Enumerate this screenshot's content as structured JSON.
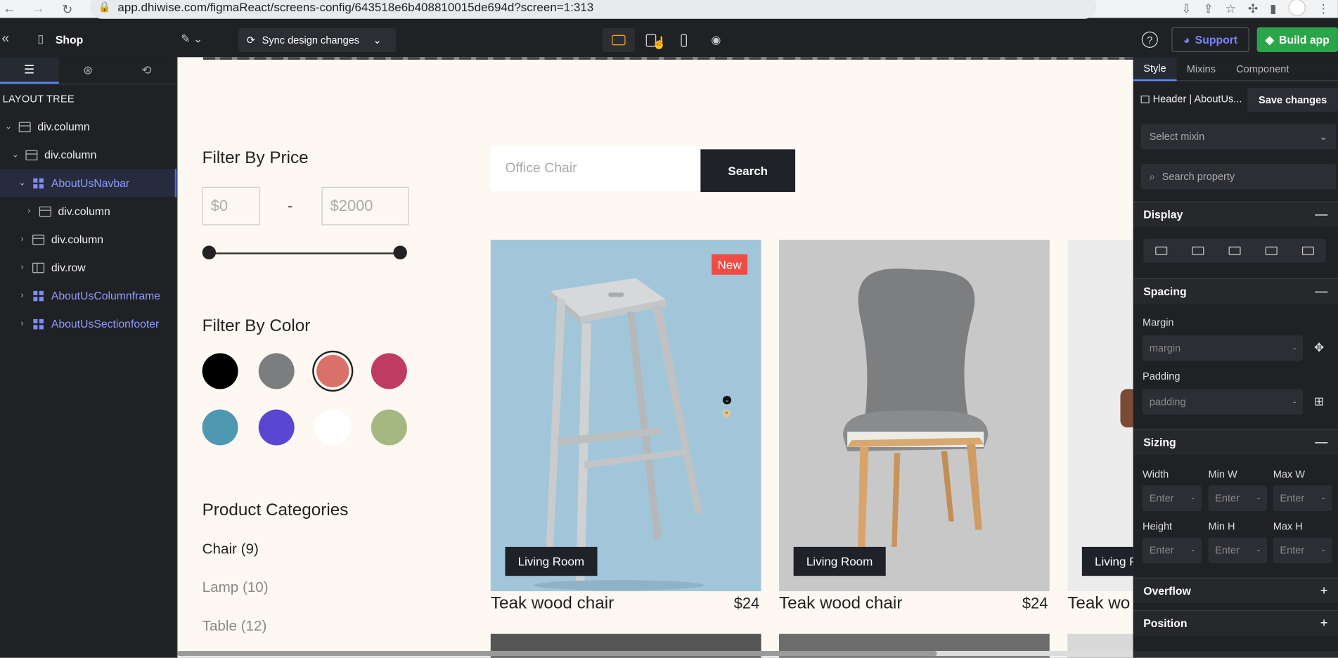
{
  "browser": {
    "url": "app.dhiwise.com/figmaReact/screens-config/643518e6b408810015de694d?screen=1:313",
    "back_icon": "arrow-left-icon",
    "forward_icon": "arrow-right-icon",
    "reload_icon": "reload-icon"
  },
  "topbar": {
    "page_title": "Shop",
    "sync_label": "Sync design changes",
    "support_label": "Support",
    "build_label": "Build app",
    "help_label": "?"
  },
  "left_panel": {
    "heading": "LAYOUT TREE",
    "tree": [
      {
        "label": "div.column",
        "type": "container"
      },
      {
        "label": "div.column",
        "type": "container"
      },
      {
        "label": "AboutUsNavbar",
        "type": "component"
      },
      {
        "label": "div.column",
        "type": "container"
      },
      {
        "label": "div.column",
        "type": "container"
      },
      {
        "label": "div.row",
        "type": "row"
      },
      {
        "label": "AboutUsColumnframe",
        "type": "component"
      },
      {
        "label": "AboutUsSectionfooter",
        "type": "component"
      }
    ]
  },
  "canvas": {
    "filter_price_title": "Filter By Price",
    "price_min": "$0",
    "price_dash": "-",
    "price_max": "$2000",
    "filter_color_title": "Filter By Color",
    "colors": [
      "#000000",
      "#7b7d7e",
      "#d9716a",
      "#c03b62",
      "#4f98b2",
      "#5a46d0",
      "#ffffff",
      "#a5b882"
    ],
    "categories_title": "Product Categories",
    "categories": [
      "Chair (9)",
      "Lamp (10)",
      "Table (12)"
    ],
    "search_placeholder": "Office Chair",
    "search_button": "Search",
    "products": [
      {
        "tag": "Living Room",
        "badge": "New",
        "name": "Teak wood chair",
        "price": "$24"
      },
      {
        "tag": "Living Room",
        "badge": "",
        "name": "Teak wood chair",
        "price": "$24"
      },
      {
        "tag": "Living R",
        "badge": "",
        "name": "Teak wo",
        "price": ""
      }
    ]
  },
  "right_panel": {
    "tabs": [
      "Style",
      "Mixins",
      "Component"
    ],
    "component_name": "Header | AboutUs...",
    "save_label": "Save changes",
    "mixin_placeholder": "Select mixin",
    "search_property_placeholder": "Search property",
    "sections": {
      "display": "Display",
      "spacing": "Spacing",
      "sizing": "Sizing",
      "overflow": "Overflow",
      "position": "Position"
    },
    "margin_label": "Margin",
    "margin_placeholder": "margin",
    "padding_label": "Padding",
    "padding_placeholder": "padding",
    "width_label": "Width",
    "min_w_label": "Min W",
    "max_w_label": "Max W",
    "height_label": "Height",
    "min_h_label": "Min H",
    "max_h_label": "Max H",
    "enter_placeholder": "Enter",
    "dash": "-"
  }
}
